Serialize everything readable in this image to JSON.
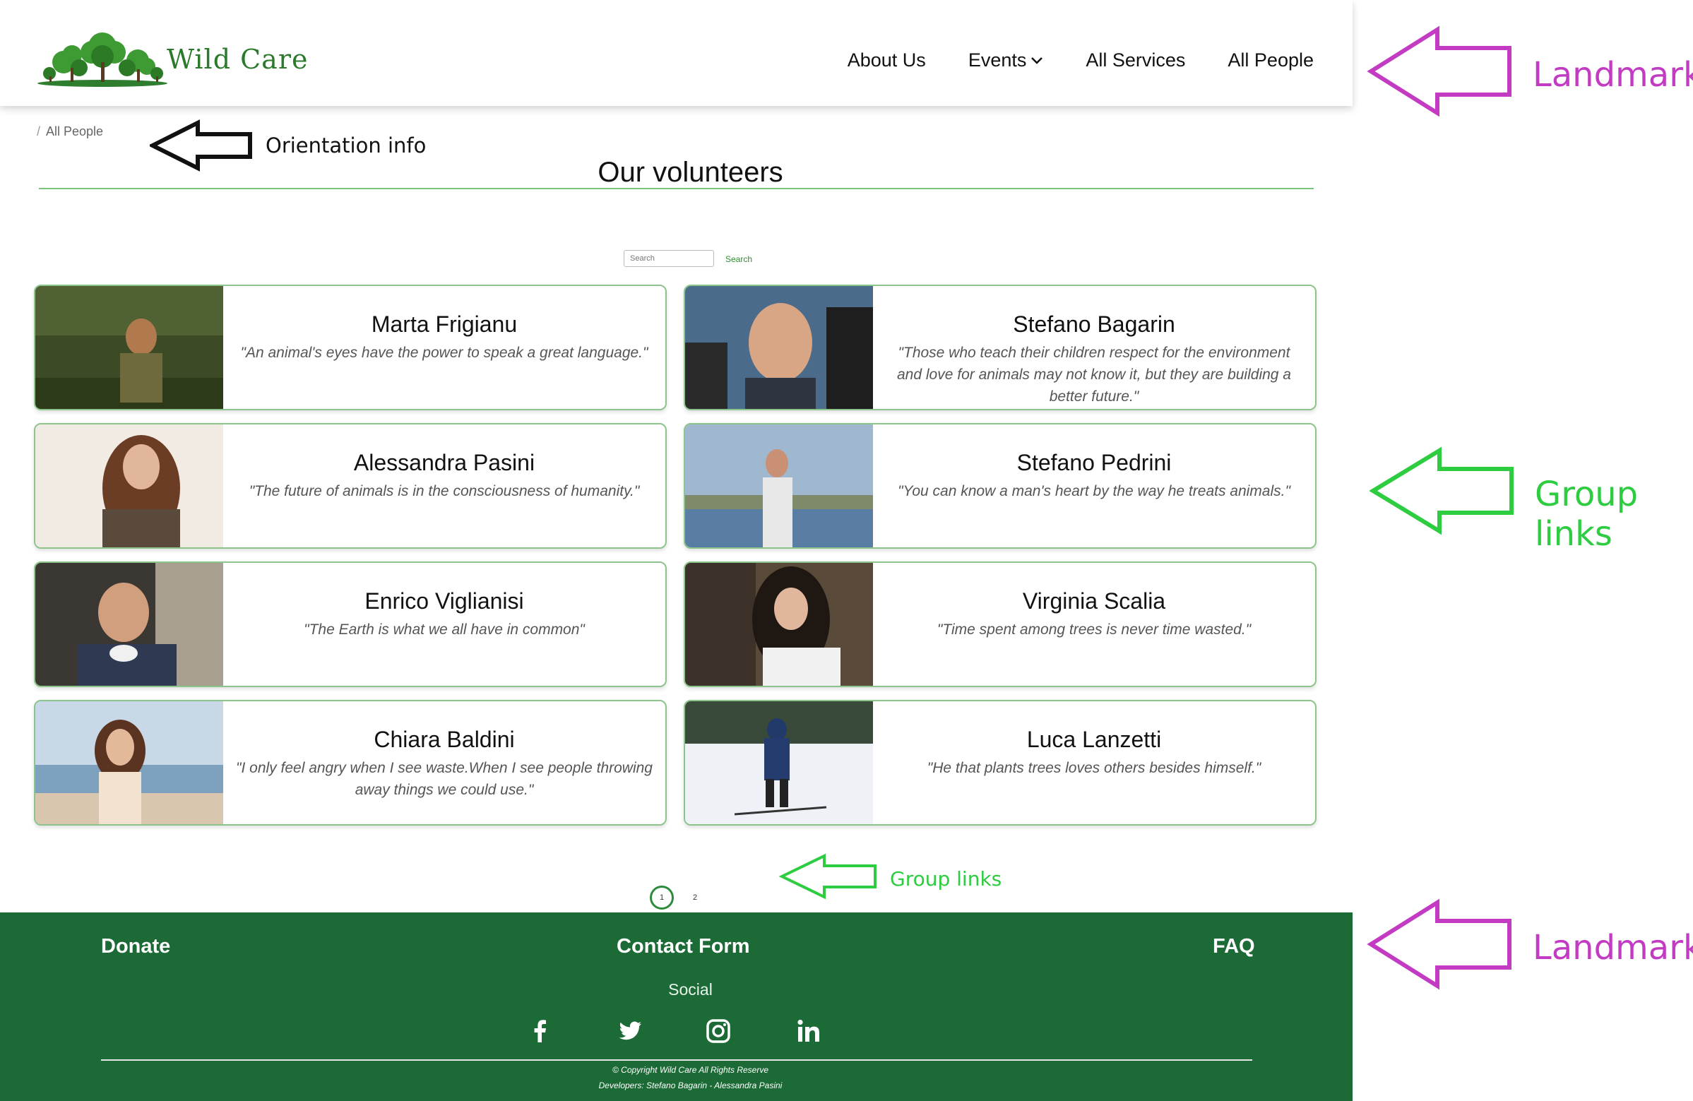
{
  "brand": {
    "name": "Wild Care"
  },
  "nav": [
    {
      "label": "About Us"
    },
    {
      "label": "Events",
      "has_dropdown": true
    },
    {
      "label": "All Services"
    },
    {
      "label": "All People"
    }
  ],
  "breadcrumb": {
    "separator": "/",
    "current": "All People"
  },
  "page": {
    "title": "Our volunteers"
  },
  "search": {
    "placeholder": "Search",
    "button_label": "Search"
  },
  "volunteers": [
    {
      "name": "Marta Frigianu",
      "quote": "\"An animal's eyes have the power to speak a great language.\""
    },
    {
      "name": "Stefano Bagarin",
      "quote": "\"Those who teach their children respect for the environment and love for animals may not know it, but they are building a better future.\""
    },
    {
      "name": "Alessandra Pasini",
      "quote": "\"The future of animals is in the consciousness of humanity.\""
    },
    {
      "name": "Stefano Pedrini",
      "quote": "\"You can know a man's heart by the way he treats animals.\""
    },
    {
      "name": "Enrico Viglianisi",
      "quote": "\"The Earth is what we all have in common\""
    },
    {
      "name": "Virginia Scalia",
      "quote": "\"Time spent among trees is never time wasted.\""
    },
    {
      "name": "Chiara Baldini",
      "quote": "\"I only feel angry when I see waste.When I see people throwing away things we could use.\""
    },
    {
      "name": "Luca Lanzetti",
      "quote": "\"He that plants trees loves others besides himself.\""
    }
  ],
  "pagination": {
    "pages": [
      "1",
      "2"
    ],
    "current": "1"
  },
  "footer": {
    "links": {
      "donate": "Donate",
      "contact": "Contact Form",
      "faq": "FAQ"
    },
    "social_label": "Social",
    "social_icons": [
      "facebook-icon",
      "twitter-icon",
      "instagram-icon",
      "linkedin-icon"
    ],
    "copyright": "© Copyright Wild Care All Rights Reserve",
    "developers": "Developers: Stefano Bagarin - Alessandra Pasini"
  },
  "annotations": {
    "landmarks": "Landmarks",
    "orientation": "Orientation info",
    "group_links": "Group links"
  },
  "colors": {
    "brand_green": "#2b7a2b",
    "footer_bg": "#1c6b37",
    "card_border": "#8bc58b",
    "annotation_magenta": "#c23bc2",
    "annotation_green": "#2ecc40"
  }
}
